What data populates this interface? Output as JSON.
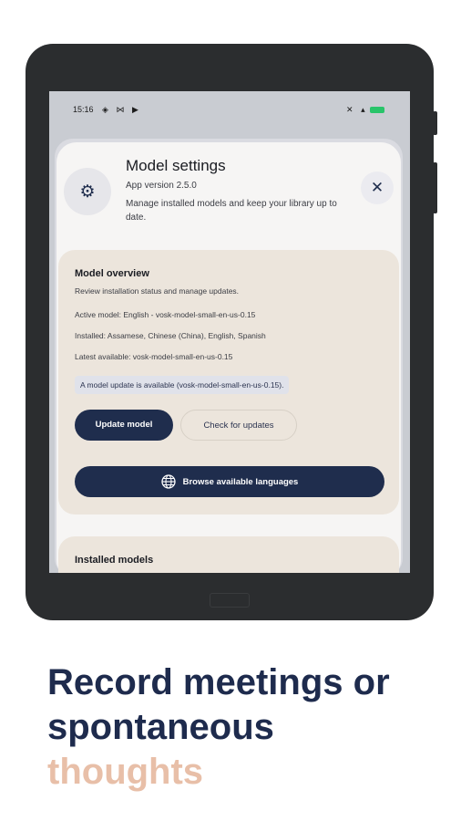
{
  "status_bar": {
    "time": "15:16",
    "left_icons": [
      "location-icon",
      "mail-icon",
      "play-icon"
    ],
    "right_icons": [
      "mute-icon",
      "signal-icon",
      "wifi-icon",
      "battery-icon"
    ]
  },
  "sheet": {
    "title": "Model settings",
    "version": "App version 2.5.0",
    "description": "Manage installed models and keep your library up to date."
  },
  "overview": {
    "title": "Model overview",
    "subtitle": "Review installation status and manage updates.",
    "active_model": "Active model: English - vosk-model-small-en-us-0.15",
    "installed": "Installed: Assamese, Chinese (China), English, Spanish",
    "latest": "Latest available: vosk-model-small-en-us-0.15",
    "update_notice": "A model update is available (vosk-model-small-en-us-0.15).",
    "update_button": "Update model",
    "check_button": "Check for updates",
    "browse_button": "Browse available languages"
  },
  "installed_models": {
    "title": "Installed models"
  },
  "caption": {
    "line1": "Record meetings or",
    "line2": "spontaneous",
    "line3": "thoughts"
  },
  "colors": {
    "primary": "#1f2d4d",
    "accent": "#e8bfa8",
    "card": "#ece5dc"
  }
}
